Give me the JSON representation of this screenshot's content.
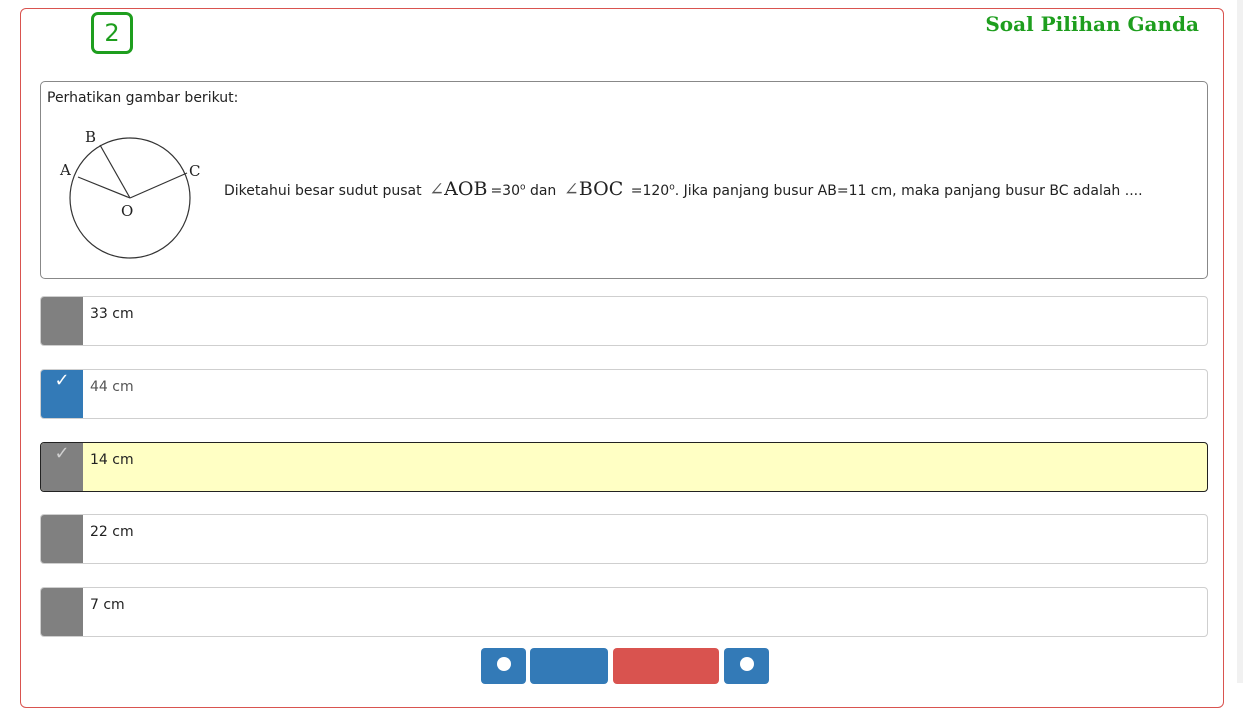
{
  "question_number": "2",
  "section_title": "Soal Pilihan Ganda",
  "question": {
    "intro": "Perhatikan gambar berikut:",
    "figure_labels": {
      "a": "A",
      "b": "B",
      "c": "C",
      "o": "O"
    },
    "text_before": "Diketahui besar sudut pusat",
    "angle1": "AOB",
    "after_angle1": "=30",
    "degree1": "o",
    "middle": "dan",
    "angle2": "BOC",
    "after_angle2": "=120",
    "degree2": "o",
    "text_after": ". Jika panjang busur AB=11 cm, maka panjang busur BC adalah ...."
  },
  "options": [
    {
      "label": "33 cm",
      "state": "none"
    },
    {
      "label": "44 cm",
      "state": "checked",
      "mark": "✓"
    },
    {
      "label": "14 cm",
      "state": "focused",
      "mark": "✓"
    },
    {
      "label": "22 cm",
      "state": "none"
    },
    {
      "label": "7 cm",
      "state": "none"
    }
  ],
  "colors": {
    "accent_green": "#1e9e1e",
    "check_blue": "#337ab7",
    "danger_red": "#d9534f",
    "focus_yellow": "#ffffc4"
  },
  "icons": [
    "check-icon",
    "circle-icon"
  ]
}
